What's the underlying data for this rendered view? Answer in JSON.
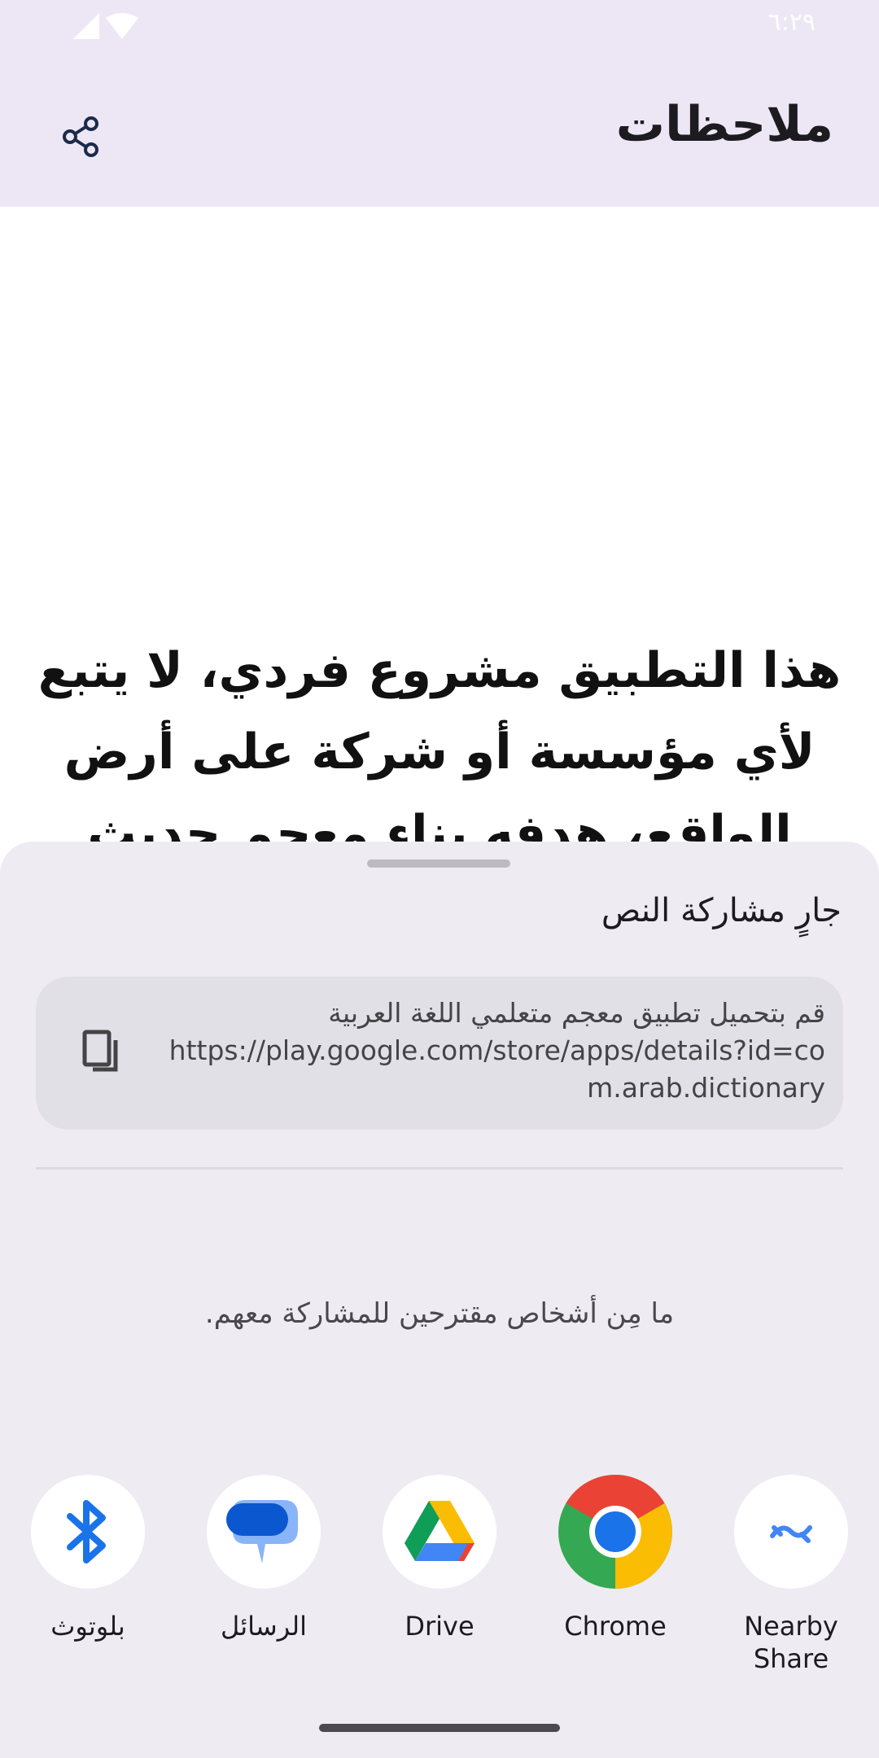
{
  "status_bar": {
    "time": "٦:٢٩"
  },
  "app_bar": {
    "title": "ملاحظات",
    "share_icon": "share-icon"
  },
  "content": {
    "text": "هذا التطبيق مشروع فردي، لا يتبع لأي مؤسسة أو شركة على أرض الواقع، هدفه بناء معجم حديث لمتعلمي اللغة"
  },
  "share_sheet": {
    "title": "جارٍ مشاركة النص",
    "preview_line1": "قم بتحميل تطبيق معجم متعلمي اللغة العربية",
    "preview_url": "https://play.google.com/store/apps/details?id=com.arab.dictionary",
    "copy_icon": "copy-icon",
    "no_people": "ما مِن أشخاص مقترحين للمشاركة معهم.",
    "targets": [
      {
        "label": "Nearby Share",
        "icon": "nearby-share-icon"
      },
      {
        "label": "Chrome",
        "icon": "chrome-icon"
      },
      {
        "label": "Drive",
        "icon": "drive-icon"
      },
      {
        "label": "الرسائل",
        "icon": "messages-icon"
      },
      {
        "label": "بلوتوث",
        "icon": "bluetooth-icon"
      }
    ]
  },
  "colors": {
    "app_bar": "#ede7f5",
    "sheet": "#eeecf2",
    "preview": "#e2e0e7",
    "bluetooth": "#1a73e8",
    "messages": "#0b57d0"
  }
}
